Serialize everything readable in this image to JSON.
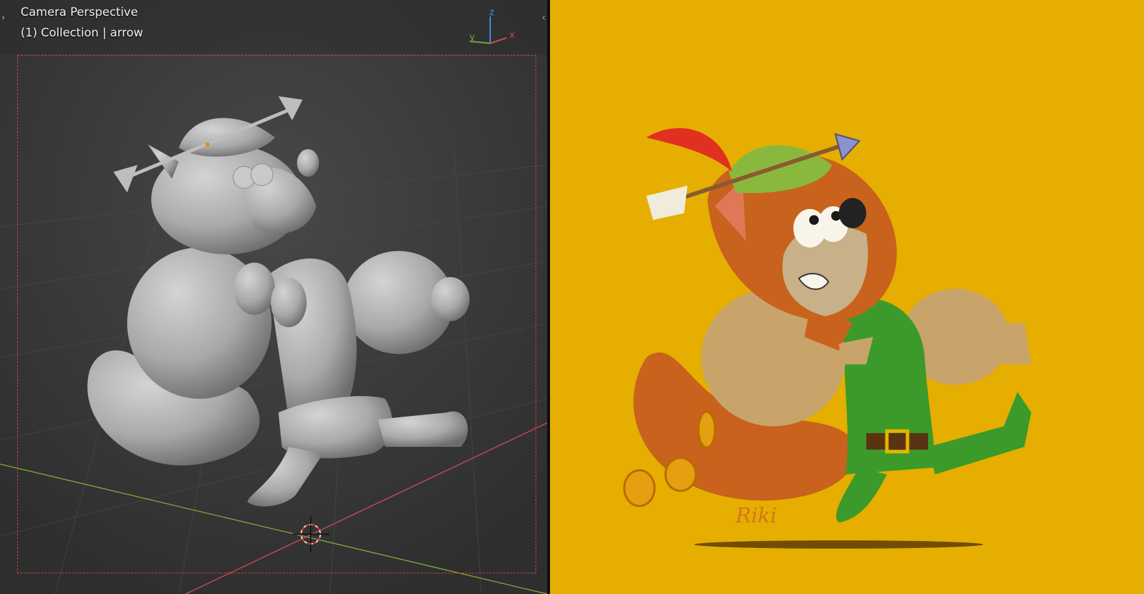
{
  "viewport": {
    "view_name": "Camera Perspective",
    "collection_label": "(1) Collection | arrow",
    "gizmo": {
      "z": "z",
      "y": "y",
      "x": "x"
    },
    "colors": {
      "background": "#3a3a3a",
      "axis_x": "#c94a5b",
      "axis_y": "#7da63a",
      "axis_z": "#3e8ee8",
      "frame": "#cc4444"
    }
  },
  "artwork": {
    "signature": "Riki",
    "colors": {
      "background": "#e6ae00",
      "fur": "#c8621c",
      "tunic": "#3c9a2a",
      "hat": "#8ab83c",
      "feather": "#e03020",
      "sack": "#c9a46a",
      "coin": "#e4a010"
    }
  }
}
